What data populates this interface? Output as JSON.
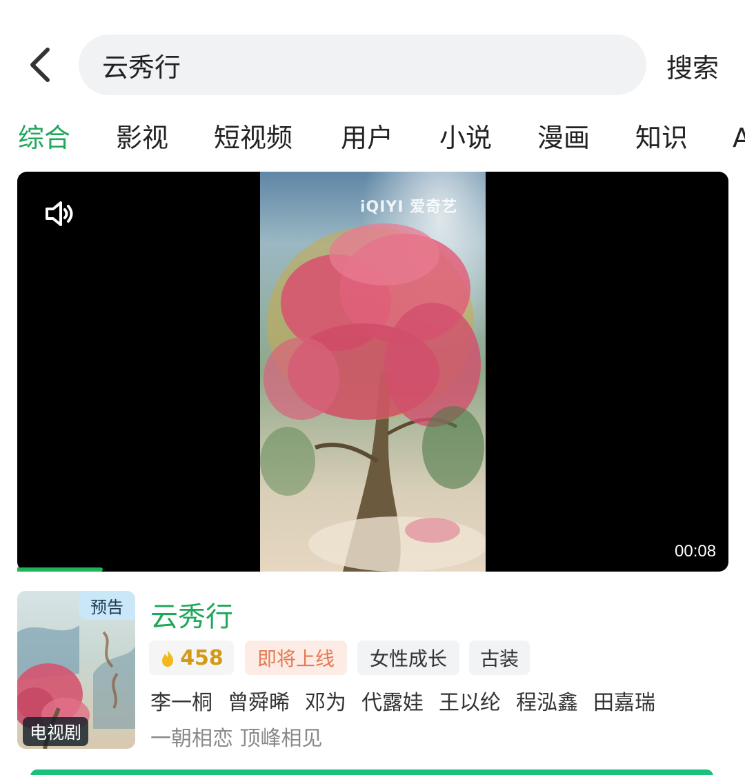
{
  "search": {
    "query": "云秀行",
    "button_label": "搜索"
  },
  "tabs": [
    {
      "label": "综合",
      "active": true
    },
    {
      "label": "影视",
      "active": false
    },
    {
      "label": "短视频",
      "active": false
    },
    {
      "label": "用户",
      "active": false
    },
    {
      "label": "小说",
      "active": false
    },
    {
      "label": "漫画",
      "active": false
    },
    {
      "label": "知识",
      "active": false
    },
    {
      "label": "A",
      "active": false
    }
  ],
  "video": {
    "watermark": "iQIYI 爱奇艺",
    "duration": "00:08",
    "progress": 0.12
  },
  "result": {
    "badge_preview": "预告",
    "badge_type": "电视剧",
    "title": "云秀行",
    "heat": "458",
    "tags": [
      "即将上线",
      "女性成长",
      "古装"
    ],
    "cast": [
      "李一桐",
      "曾舜晞",
      "邓为",
      "代露娃",
      "王以纶",
      "程泓鑫",
      "田嘉瑞"
    ],
    "slogan": "一朝相恋 顶峰相见"
  },
  "colors": {
    "accent": "#1fa75a",
    "soon_tag": "#e27a52",
    "heat": "#d39a14"
  }
}
